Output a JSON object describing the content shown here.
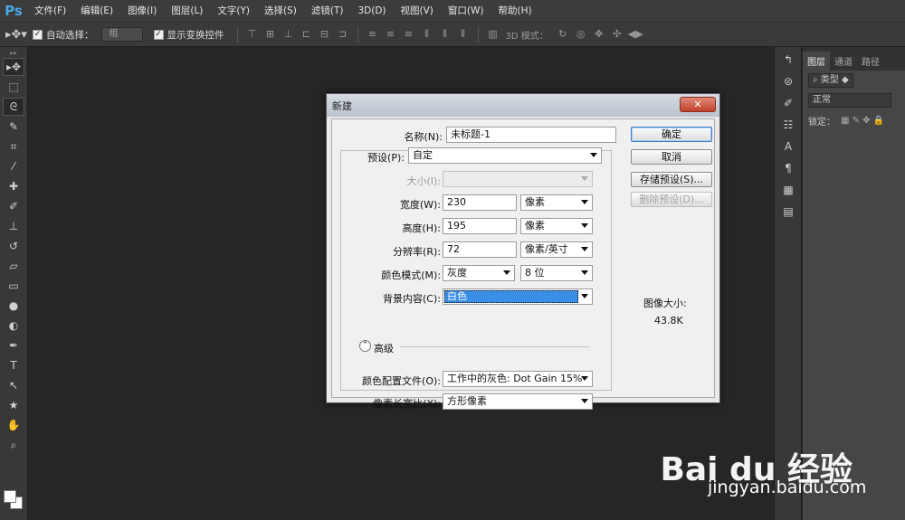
{
  "app": {
    "logo": "Ps"
  },
  "menu": [
    "文件(F)",
    "编辑(E)",
    "图像(I)",
    "图层(L)",
    "文字(Y)",
    "选择(S)",
    "滤镜(T)",
    "3D(D)",
    "视图(V)",
    "窗口(W)",
    "帮助(H)"
  ],
  "options": {
    "auto_select_label": "自动选择：",
    "auto_select_value": "组",
    "show_transform_label": "显示变换控件",
    "mode3d_label": "3D 模式："
  },
  "panel": {
    "tabs": [
      "图层",
      "通道",
      "路径"
    ],
    "filter_label": "类型",
    "blend_mode": "正常",
    "lock_label": "锁定："
  },
  "dialog": {
    "title": "新建",
    "name_label": "名称(N):",
    "name_value": "未标题-1",
    "preset_label": "预设(P):",
    "preset_value": "自定",
    "size_label": "大小(I):",
    "size_value": "",
    "width_label": "宽度(W):",
    "width_value": "230",
    "width_unit": "像素",
    "height_label": "高度(H):",
    "height_value": "195",
    "height_unit": "像素",
    "resolution_label": "分辨率(R):",
    "resolution_value": "72",
    "resolution_unit": "像素/英寸",
    "color_mode_label": "颜色模式(M):",
    "color_mode_value": "灰度",
    "bit_depth": "8 位",
    "bg_label": "背景内容(C):",
    "bg_value": "白色",
    "advanced_label": "高级",
    "color_profile_label": "颜色配置文件(O):",
    "color_profile_value": "工作中的灰色: Dot Gain 15%",
    "pixel_aspect_label": "像素长宽比(X):",
    "pixel_aspect_value": "方形像素",
    "ok_button": "确定",
    "cancel_button": "取消",
    "save_preset_button": "存储预设(S)...",
    "delete_preset_button": "删除预设(D)...",
    "image_size_label": "图像大小:",
    "image_size_value": "43.8K"
  },
  "watermark": {
    "brand": "Bai du 经验",
    "url": "jingyan.baidu.com"
  }
}
